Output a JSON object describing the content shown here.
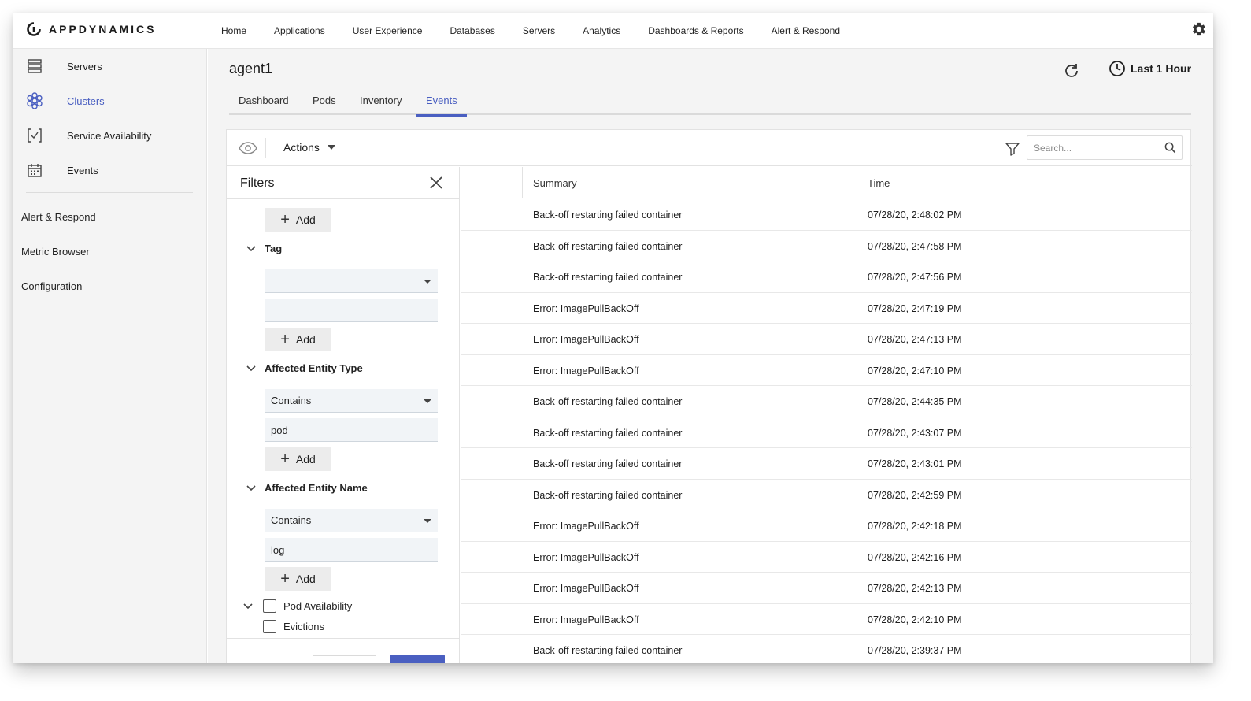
{
  "app": {
    "brand": "APPDYNAMICS",
    "accent": "#4a5fc1"
  },
  "topnav": [
    "Home",
    "Applications",
    "User Experience",
    "Databases",
    "Servers",
    "Analytics",
    "Dashboards & Reports",
    "Alert & Respond"
  ],
  "sidebar": {
    "items": [
      {
        "label": "Servers",
        "icon": "servers-icon"
      },
      {
        "label": "Clusters",
        "icon": "clusters-icon",
        "active": true
      },
      {
        "label": "Service Availability",
        "icon": "service-availability-icon"
      },
      {
        "label": "Events",
        "icon": "calendar-icon"
      }
    ],
    "links": [
      "Alert & Respond",
      "Metric Browser",
      "Configuration"
    ]
  },
  "page": {
    "title": "agent1",
    "time_range": "Last 1 Hour"
  },
  "tabs": [
    "Dashboard",
    "Pods",
    "Inventory",
    "Events"
  ],
  "toolbar": {
    "actions_label": "Actions",
    "search_placeholder": "Search..."
  },
  "filters": {
    "title": "Filters",
    "add_label": "Add",
    "sections": {
      "tag": {
        "label": "Tag",
        "operator": "",
        "value": ""
      },
      "affected_entity_type": {
        "label": "Affected Entity Type",
        "operator": "Contains",
        "value": "pod"
      },
      "affected_entity_name": {
        "label": "Affected Entity Name",
        "operator": "Contains",
        "value": "log"
      }
    },
    "checks": [
      {
        "label": "Pod Availability",
        "checked": false
      },
      {
        "label": "Evictions",
        "checked": false
      }
    ]
  },
  "table": {
    "columns": [
      "Summary",
      "Time"
    ],
    "rows": [
      {
        "summary": "Back-off restarting failed container",
        "time": "07/28/20, 2:48:02 PM"
      },
      {
        "summary": "Back-off restarting failed container",
        "time": "07/28/20, 2:47:58 PM"
      },
      {
        "summary": "Back-off restarting failed container",
        "time": "07/28/20, 2:47:56 PM"
      },
      {
        "summary": "Error: ImagePullBackOff",
        "time": "07/28/20, 2:47:19 PM"
      },
      {
        "summary": "Error: ImagePullBackOff",
        "time": "07/28/20, 2:47:13 PM"
      },
      {
        "summary": "Error: ImagePullBackOff",
        "time": "07/28/20, 2:47:10 PM"
      },
      {
        "summary": "Back-off restarting failed container",
        "time": "07/28/20, 2:44:35 PM"
      },
      {
        "summary": "Back-off restarting failed container",
        "time": "07/28/20, 2:43:07 PM"
      },
      {
        "summary": "Back-off restarting failed container",
        "time": "07/28/20, 2:43:01 PM"
      },
      {
        "summary": "Back-off restarting failed container",
        "time": "07/28/20, 2:42:59 PM"
      },
      {
        "summary": "Error: ImagePullBackOff",
        "time": "07/28/20, 2:42:18 PM"
      },
      {
        "summary": "Error: ImagePullBackOff",
        "time": "07/28/20, 2:42:16 PM"
      },
      {
        "summary": "Error: ImagePullBackOff",
        "time": "07/28/20, 2:42:13 PM"
      },
      {
        "summary": "Error: ImagePullBackOff",
        "time": "07/28/20, 2:42:10 PM"
      },
      {
        "summary": "Back-off restarting failed container",
        "time": "07/28/20, 2:39:37 PM"
      }
    ]
  }
}
